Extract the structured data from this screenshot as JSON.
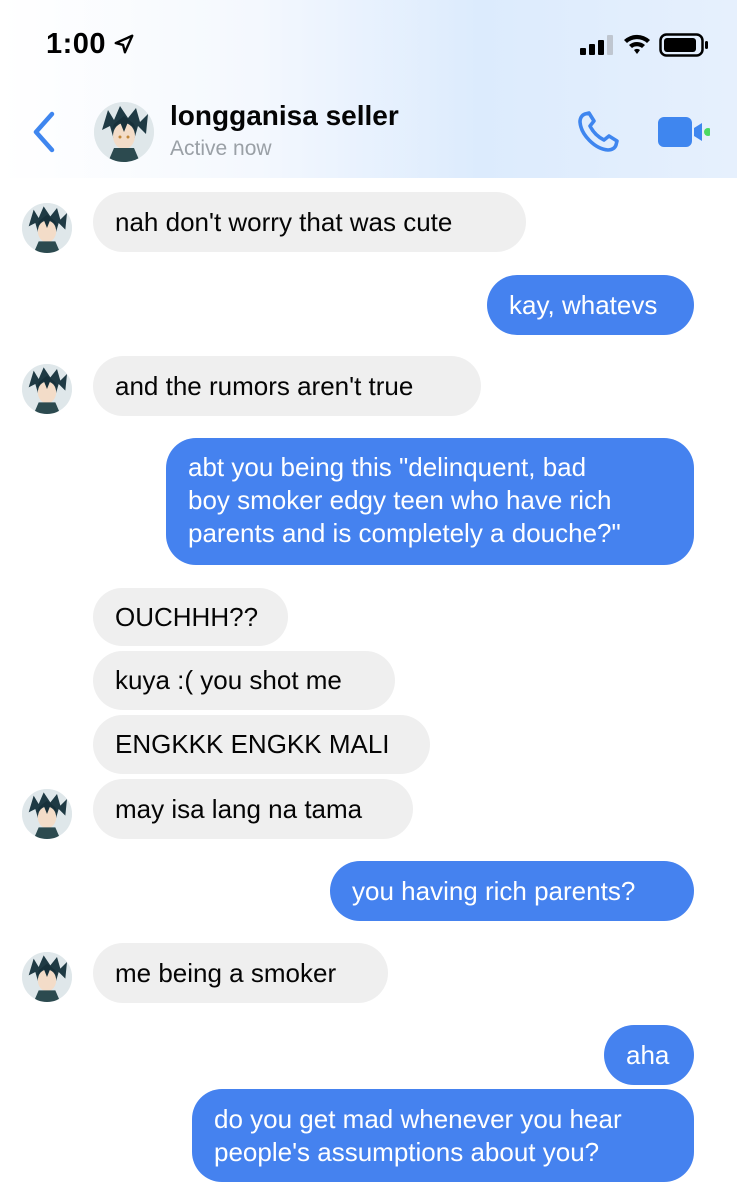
{
  "status_bar": {
    "time": "1:00",
    "icons": [
      "location-arrow-icon",
      "signal-icon",
      "wifi-icon",
      "battery-icon"
    ]
  },
  "header": {
    "contact_name": "longganisa seller",
    "status": "Active now",
    "icons": [
      "back-chevron-icon",
      "phone-icon",
      "video-camera-icon"
    ]
  },
  "colors": {
    "accent": "#4582ef",
    "incoming_bubble": "#efefef",
    "active_green": "#4cd964"
  },
  "messages": [
    {
      "from": "them",
      "text": "nah don't worry that was cute"
    },
    {
      "from": "me",
      "text": "kay, whatevs"
    },
    {
      "from": "them",
      "text": "and the rumors aren't true"
    },
    {
      "from": "me",
      "lines": [
        "abt you being this \"delinquent, bad",
        "boy smoker edgy teen who have rich",
        "parents and is completely a douche?\""
      ]
    },
    {
      "from": "them",
      "text": "OUCHHH??"
    },
    {
      "from": "them",
      "text": "kuya :( you shot me"
    },
    {
      "from": "them",
      "text": "ENGKKK ENGKK MALI"
    },
    {
      "from": "them",
      "text": "may isa lang na tama"
    },
    {
      "from": "me",
      "text": "you having rich parents?"
    },
    {
      "from": "them",
      "text": "me being a smoker"
    },
    {
      "from": "me",
      "text": "aha"
    },
    {
      "from": "me",
      "lines": [
        "do you get mad whenever you hear",
        "people's assumptions about you?"
      ]
    }
  ]
}
